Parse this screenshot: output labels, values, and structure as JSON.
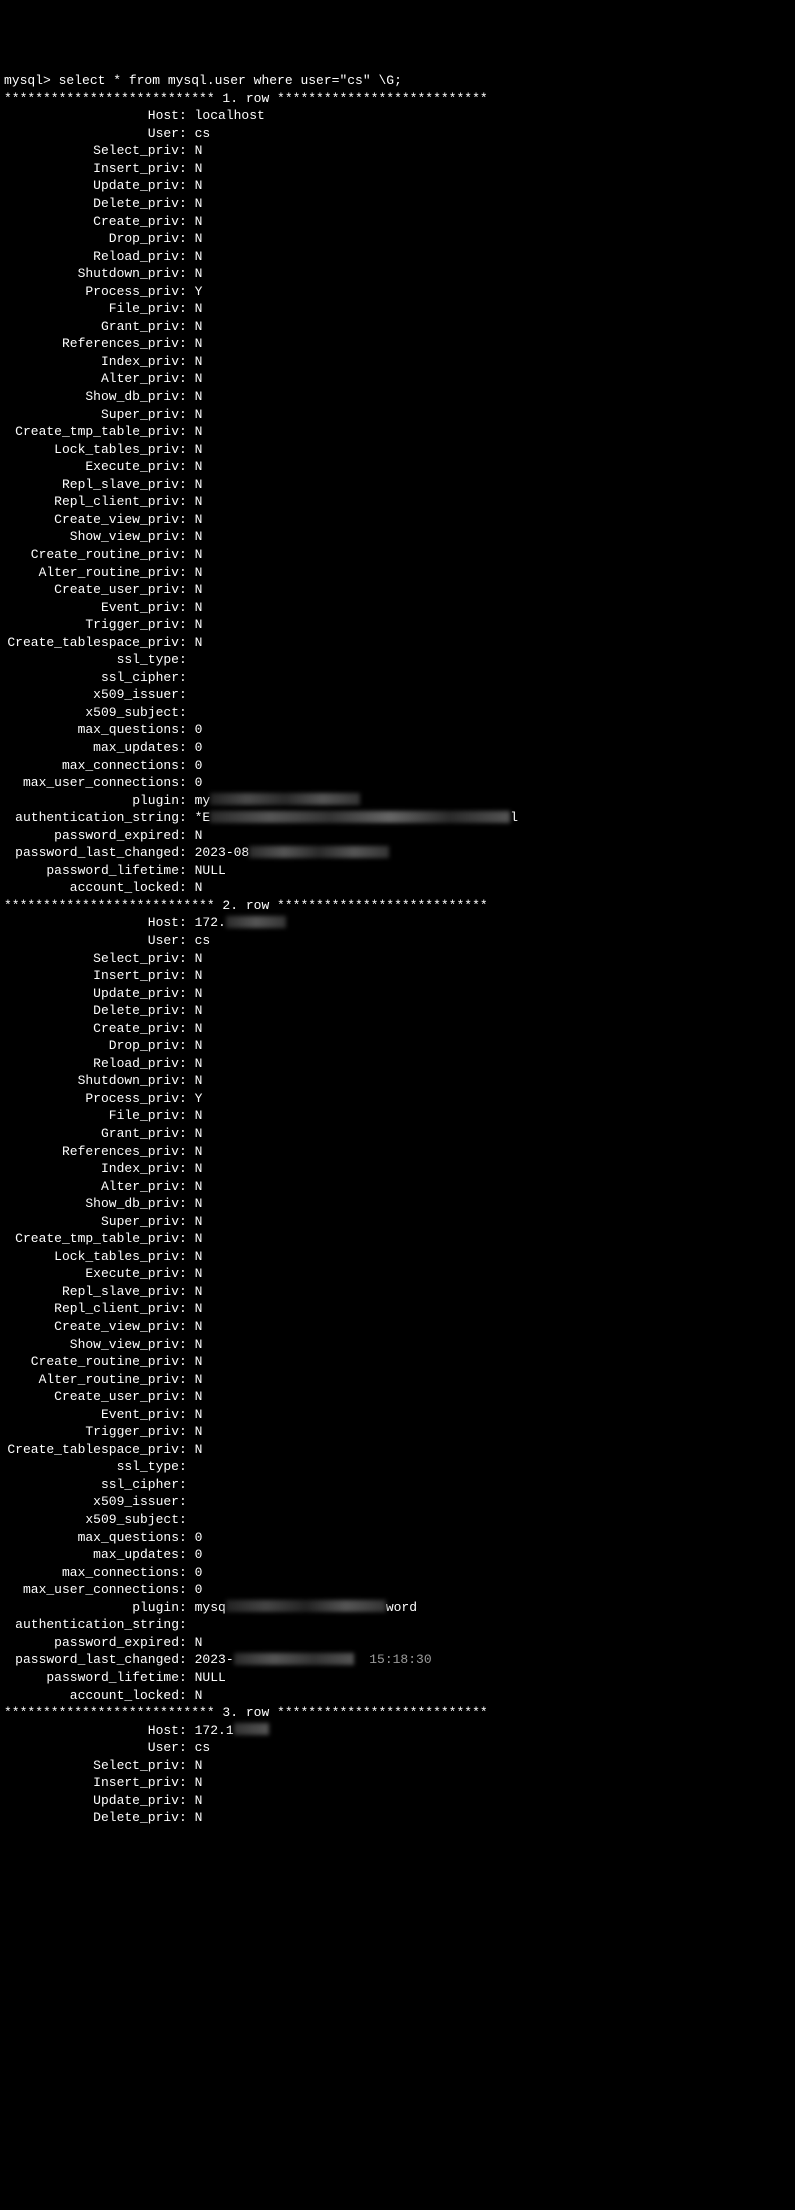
{
  "prompt": "mysql> select * from mysql.user where user=\"cs\" \\G;",
  "row_sep_template": "*************************** {n}. row ***************************",
  "fields_common": [
    "Host",
    "User",
    "Select_priv",
    "Insert_priv",
    "Update_priv",
    "Delete_priv",
    "Create_priv",
    "Drop_priv",
    "Reload_priv",
    "Shutdown_priv",
    "Process_priv",
    "File_priv",
    "Grant_priv",
    "References_priv",
    "Index_priv",
    "Alter_priv",
    "Show_db_priv",
    "Super_priv",
    "Create_tmp_table_priv",
    "Lock_tables_priv",
    "Execute_priv",
    "Repl_slave_priv",
    "Repl_client_priv",
    "Create_view_priv",
    "Show_view_priv",
    "Create_routine_priv",
    "Alter_routine_priv",
    "Create_user_priv",
    "Event_priv",
    "Trigger_priv",
    "Create_tablespace_priv",
    "ssl_type",
    "ssl_cipher",
    "x509_issuer",
    "x509_subject",
    "max_questions",
    "max_updates",
    "max_connections",
    "max_user_connections",
    "plugin",
    "authentication_string",
    "password_expired",
    "password_last_changed",
    "password_lifetime",
    "account_locked"
  ],
  "rows": [
    {
      "n": 1,
      "values": {
        "Host": {
          "text": "localhost"
        },
        "User": {
          "text": "cs"
        },
        "Select_priv": {
          "text": "N"
        },
        "Insert_priv": {
          "text": "N"
        },
        "Update_priv": {
          "text": "N"
        },
        "Delete_priv": {
          "text": "N"
        },
        "Create_priv": {
          "text": "N"
        },
        "Drop_priv": {
          "text": "N"
        },
        "Reload_priv": {
          "text": "N"
        },
        "Shutdown_priv": {
          "text": "N"
        },
        "Process_priv": {
          "text": "Y"
        },
        "File_priv": {
          "text": "N"
        },
        "Grant_priv": {
          "text": "N"
        },
        "References_priv": {
          "text": "N"
        },
        "Index_priv": {
          "text": "N"
        },
        "Alter_priv": {
          "text": "N"
        },
        "Show_db_priv": {
          "text": "N"
        },
        "Super_priv": {
          "text": "N"
        },
        "Create_tmp_table_priv": {
          "text": "N"
        },
        "Lock_tables_priv": {
          "text": "N"
        },
        "Execute_priv": {
          "text": "N"
        },
        "Repl_slave_priv": {
          "text": "N"
        },
        "Repl_client_priv": {
          "text": "N"
        },
        "Create_view_priv": {
          "text": "N"
        },
        "Show_view_priv": {
          "text": "N"
        },
        "Create_routine_priv": {
          "text": "N"
        },
        "Alter_routine_priv": {
          "text": "N"
        },
        "Create_user_priv": {
          "text": "N"
        },
        "Event_priv": {
          "text": "N"
        },
        "Trigger_priv": {
          "text": "N"
        },
        "Create_tablespace_priv": {
          "text": "N"
        },
        "ssl_type": {
          "text": ""
        },
        "ssl_cipher": {
          "text": ""
        },
        "x509_issuer": {
          "text": ""
        },
        "x509_subject": {
          "text": ""
        },
        "max_questions": {
          "text": "0"
        },
        "max_updates": {
          "text": "0"
        },
        "max_connections": {
          "text": "0"
        },
        "max_user_connections": {
          "text": "0"
        },
        "plugin": {
          "prefix": "my",
          "redact": "r1"
        },
        "authentication_string": {
          "prefix": "*E",
          "redact": "r2",
          "suffix": "l"
        },
        "password_expired": {
          "text": "N"
        },
        "password_last_changed": {
          "prefix": "2023-08",
          "redact": "r3"
        },
        "password_lifetime": {
          "text": "NULL"
        },
        "account_locked": {
          "text": "N"
        }
      }
    },
    {
      "n": 2,
      "values": {
        "Host": {
          "prefix": "172.",
          "redact": "r4"
        },
        "User": {
          "text": "cs"
        },
        "Select_priv": {
          "text": "N"
        },
        "Insert_priv": {
          "text": "N"
        },
        "Update_priv": {
          "text": "N"
        },
        "Delete_priv": {
          "text": "N"
        },
        "Create_priv": {
          "text": "N"
        },
        "Drop_priv": {
          "text": "N"
        },
        "Reload_priv": {
          "text": "N"
        },
        "Shutdown_priv": {
          "text": "N"
        },
        "Process_priv": {
          "text": "Y"
        },
        "File_priv": {
          "text": "N"
        },
        "Grant_priv": {
          "text": "N"
        },
        "References_priv": {
          "text": "N"
        },
        "Index_priv": {
          "text": "N"
        },
        "Alter_priv": {
          "text": "N"
        },
        "Show_db_priv": {
          "text": "N"
        },
        "Super_priv": {
          "text": "N"
        },
        "Create_tmp_table_priv": {
          "text": "N"
        },
        "Lock_tables_priv": {
          "text": "N"
        },
        "Execute_priv": {
          "text": "N"
        },
        "Repl_slave_priv": {
          "text": "N"
        },
        "Repl_client_priv": {
          "text": "N"
        },
        "Create_view_priv": {
          "text": "N"
        },
        "Show_view_priv": {
          "text": "N"
        },
        "Create_routine_priv": {
          "text": "N"
        },
        "Alter_routine_priv": {
          "text": "N"
        },
        "Create_user_priv": {
          "text": "N"
        },
        "Event_priv": {
          "text": "N"
        },
        "Trigger_priv": {
          "text": "N"
        },
        "Create_tablespace_priv": {
          "text": "N"
        },
        "ssl_type": {
          "text": ""
        },
        "ssl_cipher": {
          "text": ""
        },
        "x509_issuer": {
          "text": ""
        },
        "x509_subject": {
          "text": ""
        },
        "max_questions": {
          "text": "0"
        },
        "max_updates": {
          "text": "0"
        },
        "max_connections": {
          "text": "0"
        },
        "max_user_connections": {
          "text": "0"
        },
        "plugin": {
          "prefix": "mysq",
          "redact": "r5",
          "suffix": "word",
          "mid_overlay": true
        },
        "authentication_string": {
          "text": ""
        },
        "password_expired": {
          "text": "N"
        },
        "password_last_changed": {
          "prefix": "2023-",
          "redact": "r6",
          "suffix_faint": "  15:18:30"
        },
        "password_lifetime": {
          "text": "NULL"
        },
        "account_locked": {
          "text": "N"
        }
      }
    },
    {
      "n": 3,
      "partial": true,
      "values": {
        "Host": {
          "prefix": "172.1",
          "redact": "r7"
        },
        "User": {
          "text": "cs"
        },
        "Select_priv": {
          "text": "N"
        },
        "Insert_priv": {
          "text": "N"
        },
        "Update_priv": {
          "text": "N"
        },
        "Delete_priv": {
          "text": "N"
        }
      },
      "partial_fields": [
        "Host",
        "User",
        "Select_priv",
        "Insert_priv",
        "Update_priv",
        "Delete_priv"
      ]
    }
  ]
}
